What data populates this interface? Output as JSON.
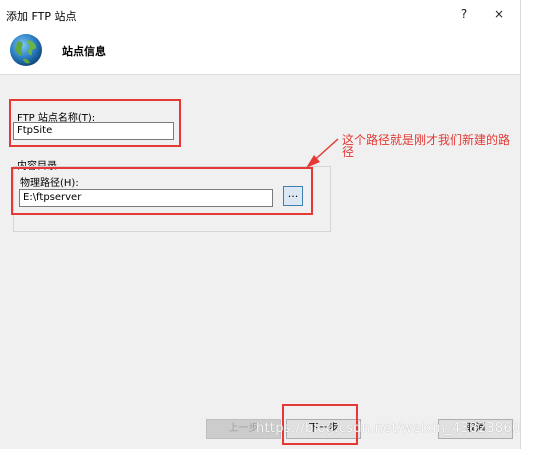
{
  "window": {
    "title": "添加 FTP 站点",
    "help_label": "?",
    "close_label": "×"
  },
  "header": {
    "title": "站点信息"
  },
  "site_name": {
    "label": "FTP 站点名称(T):",
    "value": "FtpSite"
  },
  "content_dir": {
    "group_label": "内容目录",
    "path_label": "物理路径(H):",
    "path_value": "E:\\ftpserver",
    "browse_label": "..."
  },
  "annotation": {
    "text": "这个路径就是刚才我们新建的路径",
    "color": "#e53935"
  },
  "buttons": {
    "previous": "上一步",
    "next": "下一步",
    "cancel": "取消"
  },
  "watermark": "https://blog.csdn.net/weixin_43823860"
}
